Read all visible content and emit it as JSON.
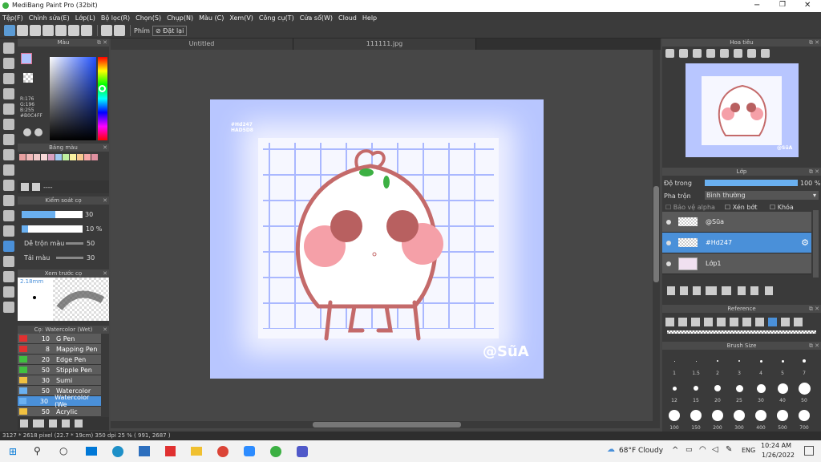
{
  "window": {
    "title": "MediBang Paint Pro (32bit)"
  },
  "menu": [
    "Tệp(F)",
    "Chỉnh sửa(E)",
    "Lớp(L)",
    "Bộ lọc(R)",
    "Chọn(S)",
    "Chụp(N)",
    "Màu (C)",
    "Xem(V)",
    "Công cụ(T)",
    "Cửa sổ(W)",
    "Cloud",
    "Help"
  ],
  "toolbar": {
    "phim_label": "Phím",
    "reset_label": "Đặt lại"
  },
  "tabs": [
    {
      "label": "Untitled"
    },
    {
      "label": "111111.jpg"
    }
  ],
  "color_panel": {
    "title": "Màu",
    "r": "R:176",
    "g": "G:196",
    "b": "B:255",
    "hex": "#B0C4FF",
    "primary": "#B0C4FF"
  },
  "palette": {
    "title": "Bảng màu",
    "dash": "----",
    "colors": [
      "#e8a0a0",
      "#f0b8b8",
      "#f0c8c8",
      "#f8d8d8",
      "#d8a0c0",
      "#a0c8f0",
      "#c0f0a0",
      "#f8f0a0",
      "#f8c890",
      "#f8a8a8",
      "#e090a0"
    ]
  },
  "brush_control": {
    "title": "Kiểm soát cọ",
    "size": "30",
    "opacity": "10 %",
    "blend_label": "Dễ trộn màu",
    "blend": "50",
    "load_label": "Tải màu",
    "load": "30"
  },
  "preview": {
    "title": "Xem trước cọ",
    "size": "2.18mm"
  },
  "brush_list": {
    "title": "Cọ: Watercolor (Wet)",
    "items": [
      {
        "size": "10",
        "name": "G Pen",
        "color": "#e03030"
      },
      {
        "size": "8",
        "name": "Mapping Pen",
        "color": "#e03030"
      },
      {
        "size": "20",
        "name": "Edge Pen",
        "color": "#40c040"
      },
      {
        "size": "50",
        "name": "Stipple Pen",
        "color": "#40c040"
      },
      {
        "size": "30",
        "name": "Sumi",
        "color": "#f0c040"
      },
      {
        "size": "50",
        "name": "Watercolor",
        "color": "#6ab0f0"
      },
      {
        "size": "30",
        "name": "Watercolor (We",
        "color": "#6ab0f0"
      },
      {
        "size": "50",
        "name": "Acrylic",
        "color": "#f0c040"
      }
    ]
  },
  "artwork": {
    "hex1": "#Hd247",
    "hex2": "HAD5D8",
    "signature": "@SũA"
  },
  "navigator": {
    "title": "Hoa tiêu",
    "signature": "@SũA"
  },
  "layer_panel": {
    "title": "Lớp",
    "opacity_label": "Độ trong",
    "opacity": "100 %",
    "blend_label": "Pha trộn",
    "blend_value": "Bình thường",
    "protect_alpha": "Bảo vệ alpha",
    "clipping": "Xén bớt",
    "lock": "Khóa",
    "layers": [
      {
        "name": "@Sũa"
      },
      {
        "name": "#Hd247"
      },
      {
        "name": "Lớp1"
      }
    ]
  },
  "reference": {
    "title": "Reference"
  },
  "brush_size": {
    "title": "Brush Size",
    "rows": [
      [
        "1",
        "1.5",
        "2",
        "3",
        "4",
        "5",
        "7"
      ],
      [
        "12",
        "15",
        "20",
        "25",
        "30",
        "40",
        "50"
      ],
      [
        "100",
        "150",
        "200",
        "300",
        "400",
        "500",
        "700"
      ]
    ]
  },
  "status": {
    "text": "3127 * 2618 pixel   (22.7 * 19cm)   350 dpi   25 %   ( 991, 2687 )"
  },
  "taskbar": {
    "weather": "68°F  Cloudy",
    "lang": "ENG",
    "time": "10:24 AM",
    "date": "1/26/2022"
  }
}
